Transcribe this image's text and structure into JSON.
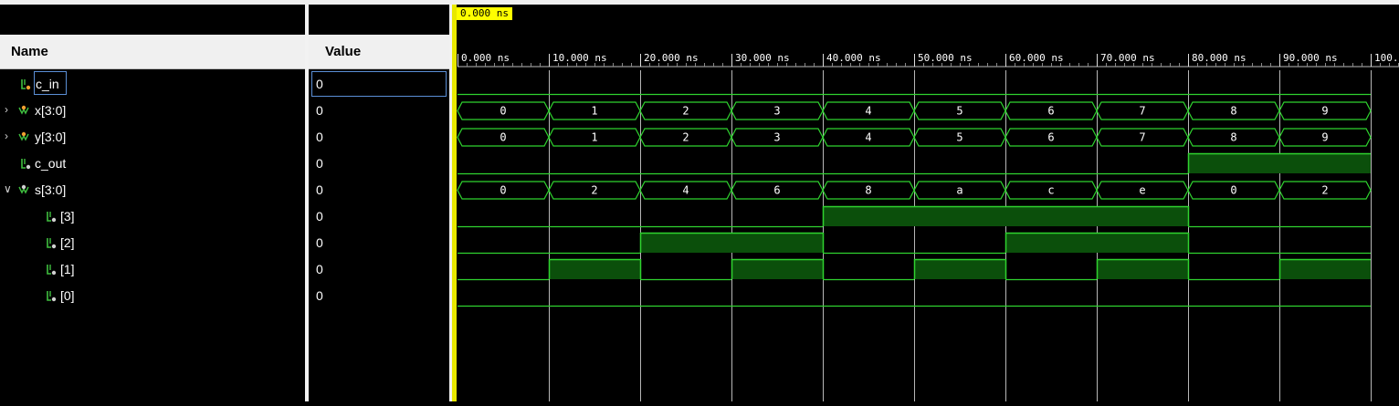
{
  "cursor": {
    "time_label": "0.000 ns"
  },
  "columns": {
    "name": "Name",
    "value": "Value"
  },
  "timeline": {
    "ticks": [
      "0.000 ns",
      "10.000 ns",
      "20.000 ns",
      "30.000 ns",
      "40.000 ns",
      "50.000 ns",
      "60.000 ns",
      "70.000 ns",
      "80.000 ns",
      "90.000 ns",
      "100."
    ]
  },
  "signals": [
    {
      "name": "c_in",
      "value": "0",
      "kind": "bit"
    },
    {
      "name": "x[3:0]",
      "value": "0",
      "kind": "bus"
    },
    {
      "name": "y[3:0]",
      "value": "0",
      "kind": "bus"
    },
    {
      "name": "c_out",
      "value": "0",
      "kind": "bit"
    },
    {
      "name": "s[3:0]",
      "value": "0",
      "kind": "bus"
    },
    {
      "name": "[3]",
      "value": "0",
      "kind": "bit"
    },
    {
      "name": "[2]",
      "value": "0",
      "kind": "bit"
    },
    {
      "name": "[1]",
      "value": "0",
      "kind": "bit"
    },
    {
      "name": "[0]",
      "value": "0",
      "kind": "bit"
    }
  ],
  "waves": {
    "c_in": [
      0,
      0,
      0,
      0,
      0,
      0,
      0,
      0,
      0,
      0
    ],
    "x": [
      "0",
      "1",
      "2",
      "3",
      "4",
      "5",
      "6",
      "7",
      "8",
      "9"
    ],
    "y": [
      "0",
      "1",
      "2",
      "3",
      "4",
      "5",
      "6",
      "7",
      "8",
      "9"
    ],
    "c_out": [
      0,
      0,
      0,
      0,
      0,
      0,
      0,
      0,
      1,
      1
    ],
    "s": [
      "0",
      "2",
      "4",
      "6",
      "8",
      "a",
      "c",
      "e",
      "0",
      "2"
    ],
    "s3": [
      0,
      0,
      0,
      0,
      1,
      1,
      1,
      1,
      0,
      0
    ],
    "s2": [
      0,
      0,
      1,
      1,
      0,
      0,
      1,
      1,
      0,
      0
    ],
    "s1": [
      0,
      1,
      0,
      1,
      0,
      1,
      0,
      1,
      0,
      1
    ],
    "s0": [
      0,
      0,
      0,
      0,
      0,
      0,
      0,
      0,
      0,
      0
    ]
  },
  "colors": {
    "wave": "#2fd32f",
    "wave_fill": "#0b4f0b",
    "grid": "#d8d8d8",
    "cursor": "#ffff00"
  }
}
